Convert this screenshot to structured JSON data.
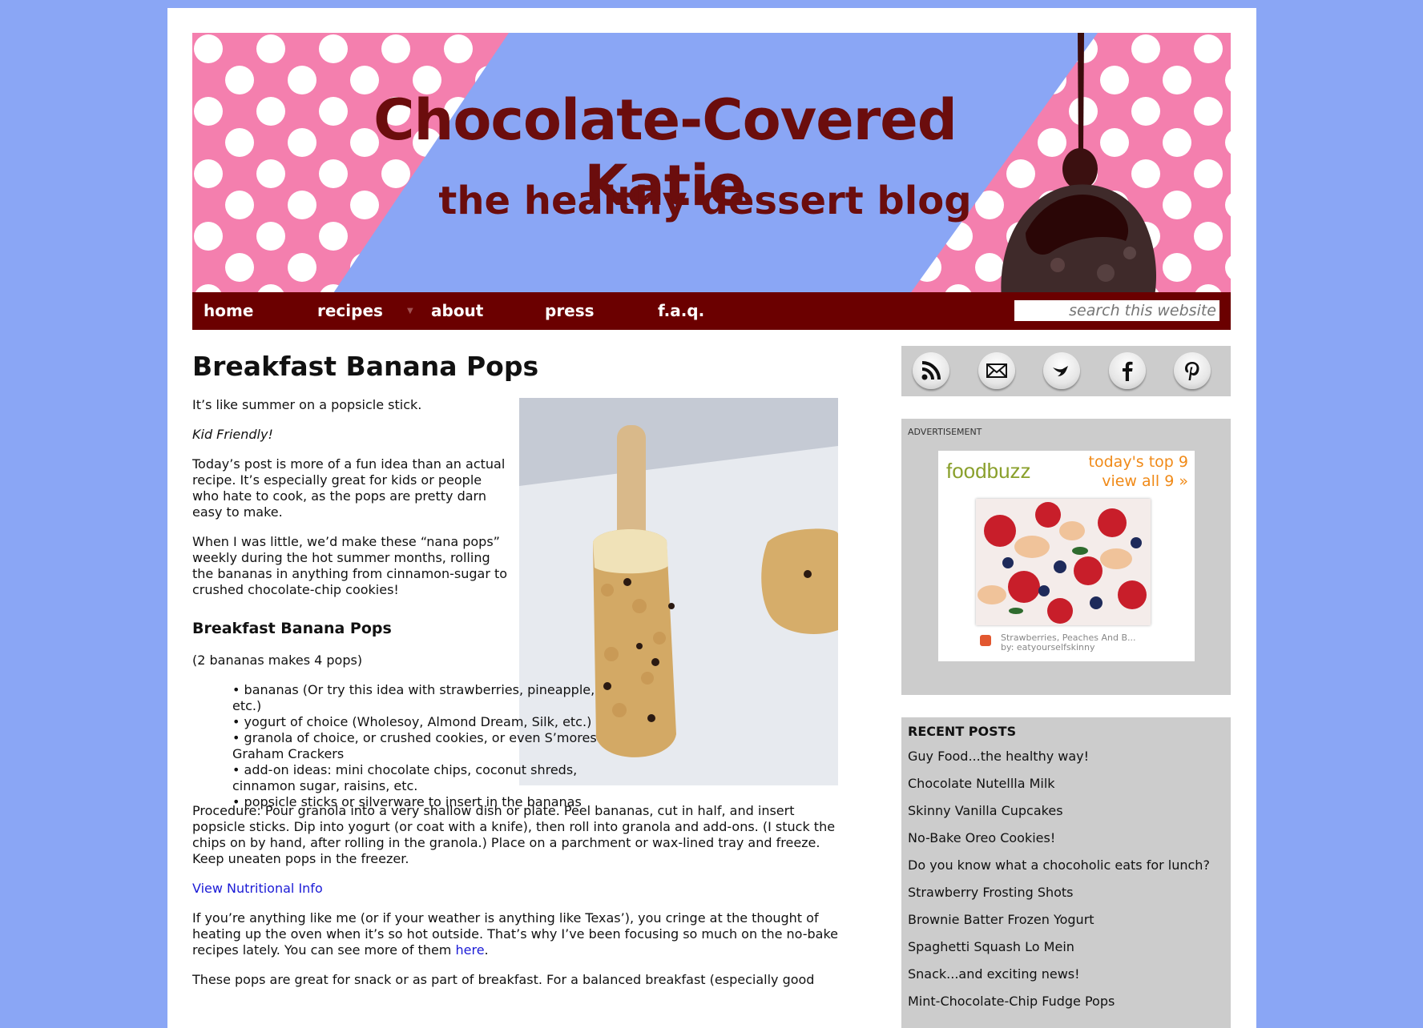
{
  "site": {
    "title": "Chocolate-Covered Katie",
    "tagline": "the healthy dessert blog"
  },
  "nav": {
    "items": [
      "home",
      "recipes",
      "about",
      "press",
      "f.a.q."
    ],
    "search_placeholder": "search this website"
  },
  "post": {
    "title": "Breakfast Banana Pops",
    "intro": "It’s like summer on a popsicle stick.",
    "kid_friendly": "Kid Friendly!",
    "para1": "Today’s post is more of a fun idea than an actual recipe. It’s especially great for kids or people who hate to cook, as the pops are pretty darn easy to make.",
    "para2": "When I was little, we’d make these “nana pops” weekly during the hot summer months, rolling the bananas in anything from cinnamon-sugar to crushed chocolate-chip cookies!",
    "recipe_title": "Breakfast Banana Pops",
    "yield": "(2 bananas makes 4 pops)",
    "ingredients": [
      "bananas (Or try this idea with strawberries, pineapple, etc.)",
      "yogurt of choice (Wholesoy, Almond Dream, Silk, etc.)",
      "granola of choice, or crushed cookies, or even S’mores Graham Crackers",
      "add-on ideas: mini chocolate chips, coconut shreds, cinnamon sugar, raisins, etc.",
      "popsicle sticks or silverware to insert in the bananas"
    ],
    "procedure": "Procedure: Pour granola into a very shallow dish or plate. Peel bananas, cut in half, and insert popsicle sticks. Dip into yogurt (or coat with a knife), then roll into granola and add-ons. (I stuck the chips on by hand, after rolling in the granola.) Place on a parchment or wax-lined tray and freeze. Keep uneaten pops in the freezer.",
    "nutrition_link": "View Nutritional Info",
    "para3_before": "If you’re anything like me (or if your weather is anything like Texas’), you cringe at the thought of heating up the oven when it’s so hot outside. That’s why I’ve been focusing so much on the no-bake recipes lately. You can see more of them ",
    "para3_link": "here",
    "para3_after": ".",
    "para4": "These pops are great for snack or as part of breakfast. For a balanced breakfast (especially good"
  },
  "sidebar": {
    "social_icons": [
      "rss-icon",
      "email-icon",
      "twitter-icon",
      "facebook-icon",
      "pinterest-icon"
    ],
    "ad_label": "ADVERTISEMENT",
    "ad": {
      "logo": "foodbuzz",
      "top_line": "today's top 9",
      "view_all": "view all 9 »",
      "caption_title": "Strawberries, Peaches And B...",
      "caption_by": "by: eatyourselfskinny"
    },
    "recent_title": "RECENT POSTS",
    "recent_posts": [
      "Guy Food...the healthy way!",
      "Chocolate Nutellla Milk",
      "Skinny Vanilla Cupcakes",
      "No-Bake Oreo Cookies!",
      "Do you know what a chocoholic eats for lunch?",
      "Strawberry Frosting Shots",
      "Brownie Batter Frozen Yogurt",
      "Spaghetti Squash Lo Mein",
      "Snack...and exciting news!",
      "Mint-Chocolate-Chip Fudge Pops"
    ]
  },
  "colors": {
    "background": "#8aa6f5",
    "banner_pink": "#f47fae",
    "nav_maroon": "#6b0000",
    "title_maroon": "#6b0d0d",
    "sidebar_gray": "#cccccc",
    "link_blue": "#1b1bd6"
  }
}
